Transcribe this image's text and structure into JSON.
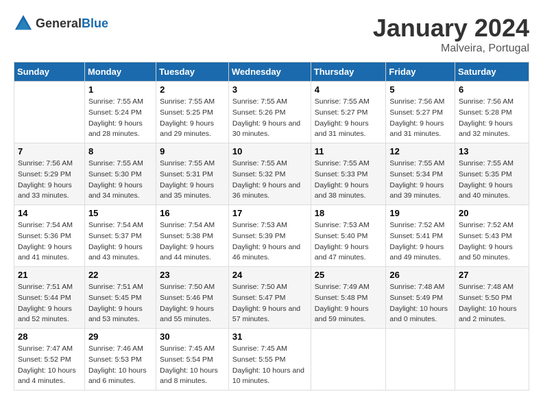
{
  "logo": {
    "general": "General",
    "blue": "Blue"
  },
  "title": "January 2024",
  "subtitle": "Malveira, Portugal",
  "header_days": [
    "Sunday",
    "Monday",
    "Tuesday",
    "Wednesday",
    "Thursday",
    "Friday",
    "Saturday"
  ],
  "weeks": [
    [
      {
        "day": "",
        "sunrise": "",
        "sunset": "",
        "daylight": ""
      },
      {
        "day": "1",
        "sunrise": "Sunrise: 7:55 AM",
        "sunset": "Sunset: 5:24 PM",
        "daylight": "Daylight: 9 hours and 28 minutes."
      },
      {
        "day": "2",
        "sunrise": "Sunrise: 7:55 AM",
        "sunset": "Sunset: 5:25 PM",
        "daylight": "Daylight: 9 hours and 29 minutes."
      },
      {
        "day": "3",
        "sunrise": "Sunrise: 7:55 AM",
        "sunset": "Sunset: 5:26 PM",
        "daylight": "Daylight: 9 hours and 30 minutes."
      },
      {
        "day": "4",
        "sunrise": "Sunrise: 7:55 AM",
        "sunset": "Sunset: 5:27 PM",
        "daylight": "Daylight: 9 hours and 31 minutes."
      },
      {
        "day": "5",
        "sunrise": "Sunrise: 7:56 AM",
        "sunset": "Sunset: 5:27 PM",
        "daylight": "Daylight: 9 hours and 31 minutes."
      },
      {
        "day": "6",
        "sunrise": "Sunrise: 7:56 AM",
        "sunset": "Sunset: 5:28 PM",
        "daylight": "Daylight: 9 hours and 32 minutes."
      }
    ],
    [
      {
        "day": "7",
        "sunrise": "Sunrise: 7:56 AM",
        "sunset": "Sunset: 5:29 PM",
        "daylight": "Daylight: 9 hours and 33 minutes."
      },
      {
        "day": "8",
        "sunrise": "Sunrise: 7:55 AM",
        "sunset": "Sunset: 5:30 PM",
        "daylight": "Daylight: 9 hours and 34 minutes."
      },
      {
        "day": "9",
        "sunrise": "Sunrise: 7:55 AM",
        "sunset": "Sunset: 5:31 PM",
        "daylight": "Daylight: 9 hours and 35 minutes."
      },
      {
        "day": "10",
        "sunrise": "Sunrise: 7:55 AM",
        "sunset": "Sunset: 5:32 PM",
        "daylight": "Daylight: 9 hours and 36 minutes."
      },
      {
        "day": "11",
        "sunrise": "Sunrise: 7:55 AM",
        "sunset": "Sunset: 5:33 PM",
        "daylight": "Daylight: 9 hours and 38 minutes."
      },
      {
        "day": "12",
        "sunrise": "Sunrise: 7:55 AM",
        "sunset": "Sunset: 5:34 PM",
        "daylight": "Daylight: 9 hours and 39 minutes."
      },
      {
        "day": "13",
        "sunrise": "Sunrise: 7:55 AM",
        "sunset": "Sunset: 5:35 PM",
        "daylight": "Daylight: 9 hours and 40 minutes."
      }
    ],
    [
      {
        "day": "14",
        "sunrise": "Sunrise: 7:54 AM",
        "sunset": "Sunset: 5:36 PM",
        "daylight": "Daylight: 9 hours and 41 minutes."
      },
      {
        "day": "15",
        "sunrise": "Sunrise: 7:54 AM",
        "sunset": "Sunset: 5:37 PM",
        "daylight": "Daylight: 9 hours and 43 minutes."
      },
      {
        "day": "16",
        "sunrise": "Sunrise: 7:54 AM",
        "sunset": "Sunset: 5:38 PM",
        "daylight": "Daylight: 9 hours and 44 minutes."
      },
      {
        "day": "17",
        "sunrise": "Sunrise: 7:53 AM",
        "sunset": "Sunset: 5:39 PM",
        "daylight": "Daylight: 9 hours and 46 minutes."
      },
      {
        "day": "18",
        "sunrise": "Sunrise: 7:53 AM",
        "sunset": "Sunset: 5:40 PM",
        "daylight": "Daylight: 9 hours and 47 minutes."
      },
      {
        "day": "19",
        "sunrise": "Sunrise: 7:52 AM",
        "sunset": "Sunset: 5:41 PM",
        "daylight": "Daylight: 9 hours and 49 minutes."
      },
      {
        "day": "20",
        "sunrise": "Sunrise: 7:52 AM",
        "sunset": "Sunset: 5:43 PM",
        "daylight": "Daylight: 9 hours and 50 minutes."
      }
    ],
    [
      {
        "day": "21",
        "sunrise": "Sunrise: 7:51 AM",
        "sunset": "Sunset: 5:44 PM",
        "daylight": "Daylight: 9 hours and 52 minutes."
      },
      {
        "day": "22",
        "sunrise": "Sunrise: 7:51 AM",
        "sunset": "Sunset: 5:45 PM",
        "daylight": "Daylight: 9 hours and 53 minutes."
      },
      {
        "day": "23",
        "sunrise": "Sunrise: 7:50 AM",
        "sunset": "Sunset: 5:46 PM",
        "daylight": "Daylight: 9 hours and 55 minutes."
      },
      {
        "day": "24",
        "sunrise": "Sunrise: 7:50 AM",
        "sunset": "Sunset: 5:47 PM",
        "daylight": "Daylight: 9 hours and 57 minutes."
      },
      {
        "day": "25",
        "sunrise": "Sunrise: 7:49 AM",
        "sunset": "Sunset: 5:48 PM",
        "daylight": "Daylight: 9 hours and 59 minutes."
      },
      {
        "day": "26",
        "sunrise": "Sunrise: 7:48 AM",
        "sunset": "Sunset: 5:49 PM",
        "daylight": "Daylight: 10 hours and 0 minutes."
      },
      {
        "day": "27",
        "sunrise": "Sunrise: 7:48 AM",
        "sunset": "Sunset: 5:50 PM",
        "daylight": "Daylight: 10 hours and 2 minutes."
      }
    ],
    [
      {
        "day": "28",
        "sunrise": "Sunrise: 7:47 AM",
        "sunset": "Sunset: 5:52 PM",
        "daylight": "Daylight: 10 hours and 4 minutes."
      },
      {
        "day": "29",
        "sunrise": "Sunrise: 7:46 AM",
        "sunset": "Sunset: 5:53 PM",
        "daylight": "Daylight: 10 hours and 6 minutes."
      },
      {
        "day": "30",
        "sunrise": "Sunrise: 7:45 AM",
        "sunset": "Sunset: 5:54 PM",
        "daylight": "Daylight: 10 hours and 8 minutes."
      },
      {
        "day": "31",
        "sunrise": "Sunrise: 7:45 AM",
        "sunset": "Sunset: 5:55 PM",
        "daylight": "Daylight: 10 hours and 10 minutes."
      },
      {
        "day": "",
        "sunrise": "",
        "sunset": "",
        "daylight": ""
      },
      {
        "day": "",
        "sunrise": "",
        "sunset": "",
        "daylight": ""
      },
      {
        "day": "",
        "sunrise": "",
        "sunset": "",
        "daylight": ""
      }
    ]
  ]
}
